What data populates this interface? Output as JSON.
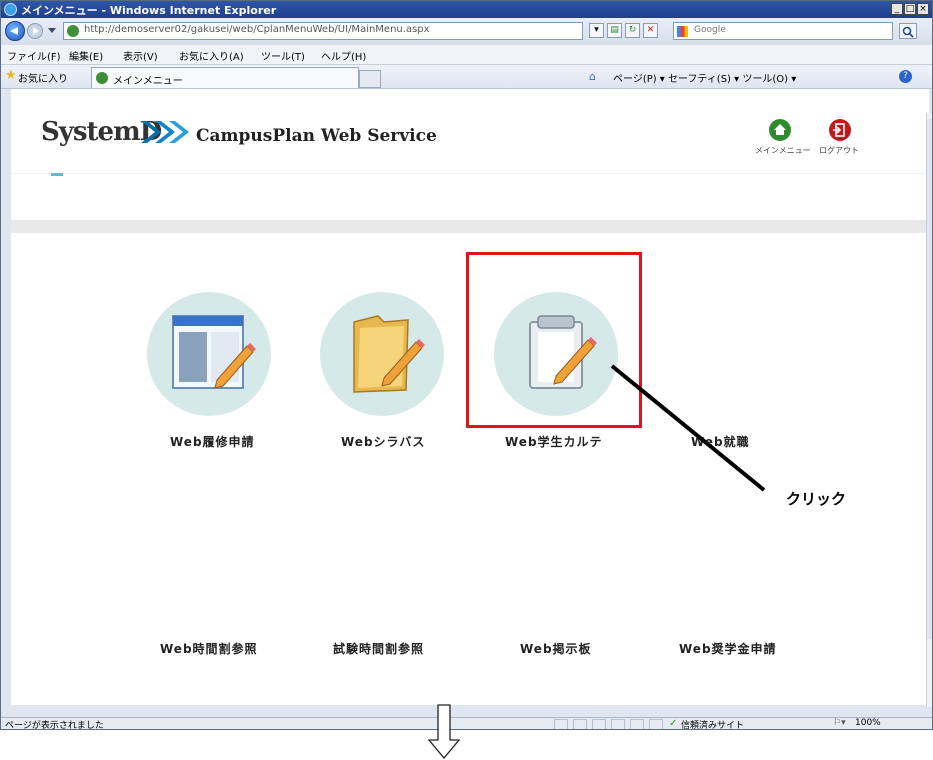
{
  "window": {
    "title": "メインメニュー - Windows Internet Explorer",
    "url": "http://demoserver02/gakusei/web/CplanMenuWeb/UI/MainMenu.aspx",
    "search_placeholder": "Google"
  },
  "menubar": {
    "items": [
      "ファイル(F)",
      "編集(E)",
      "表示(V)",
      "お気に入り(A)",
      "ツール(T)",
      "ヘルプ(H)"
    ]
  },
  "favbar": {
    "favorites_label": "お気に入り",
    "tab_label": "メインメニュー",
    "commands": "ページ(P) ▾  セーフティ(S) ▾  ツール(O) ▾"
  },
  "header": {
    "logo_text": "SystemD",
    "service_title": "CampusPlan Web Service",
    "main_menu_label": "メインメニュー",
    "logout_label": "ログアウト"
  },
  "tiles_row1": [
    {
      "label": "Web履修申請",
      "icon": "course-registration-icon"
    },
    {
      "label": "Webシラバス",
      "icon": "syllabus-folder-icon"
    },
    {
      "label": "Web学生カルテ",
      "icon": "clipboard-icon"
    },
    {
      "label": "Web就職",
      "icon": ""
    }
  ],
  "tiles_row2": [
    {
      "label": "Web時間割参照"
    },
    {
      "label": "試験時間割参照"
    },
    {
      "label": "Web掲示板"
    },
    {
      "label": "Web奨学金申請"
    }
  ],
  "annotation": {
    "click_label": "クリック"
  },
  "statusbar": {
    "status": "ページが表示されました",
    "zone": "信頼済みサイト",
    "zoom": "100%"
  },
  "colors": {
    "highlight": "#e0141c",
    "tile_circle": "#d6e9e9",
    "home_button": "#2e8b2e",
    "logout_button": "#c0181c"
  }
}
